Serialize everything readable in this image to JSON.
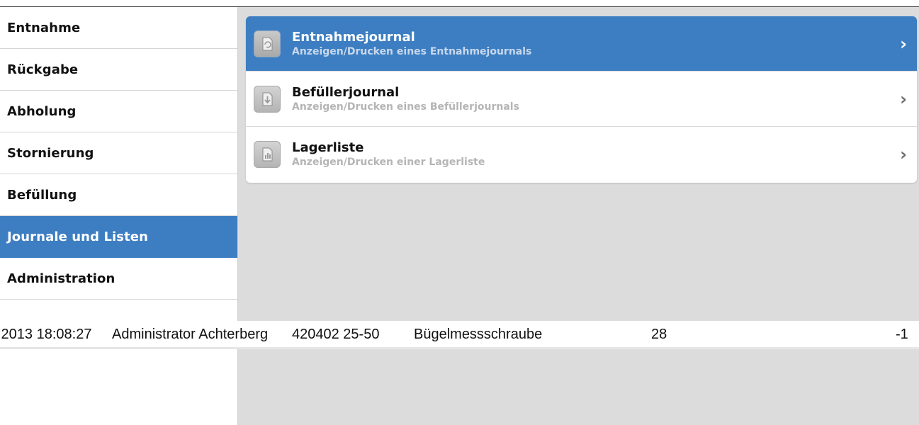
{
  "sidebar": {
    "items": [
      {
        "label": "Entnahme",
        "active": false
      },
      {
        "label": "Rückgabe",
        "active": false
      },
      {
        "label": "Abholung",
        "active": false
      },
      {
        "label": "Stornierung",
        "active": false
      },
      {
        "label": "Befüllung",
        "active": false
      },
      {
        "label": "Journale und Listen",
        "active": true
      },
      {
        "label": "Administration",
        "active": false
      }
    ]
  },
  "menu": {
    "rows": [
      {
        "title": "Entnahmejournal",
        "subtitle": "Anzeigen/Drucken eines Entnahmejournals",
        "icon": "journal-export-icon",
        "active": true
      },
      {
        "title": "Befüllerjournal",
        "subtitle": "Anzeigen/Drucken eines Befüllerjournals",
        "icon": "journal-import-icon",
        "active": false
      },
      {
        "title": "Lagerliste",
        "subtitle": "Anzeigen/Drucken einer Lagerliste",
        "icon": "stock-list-icon",
        "active": false
      }
    ],
    "chevron": "›"
  },
  "overlay_row": {
    "datetime": ".2013 18:08:27",
    "user": "Administrator Achterberg",
    "article_no": "420402 25-50",
    "description": "Bügelmessschraube",
    "number": "28",
    "quantity": "-1"
  },
  "colors": {
    "accent": "#3d7ec2",
    "content_bg": "#dcdcdc",
    "subtitle_gray": "#b5b5b5"
  }
}
